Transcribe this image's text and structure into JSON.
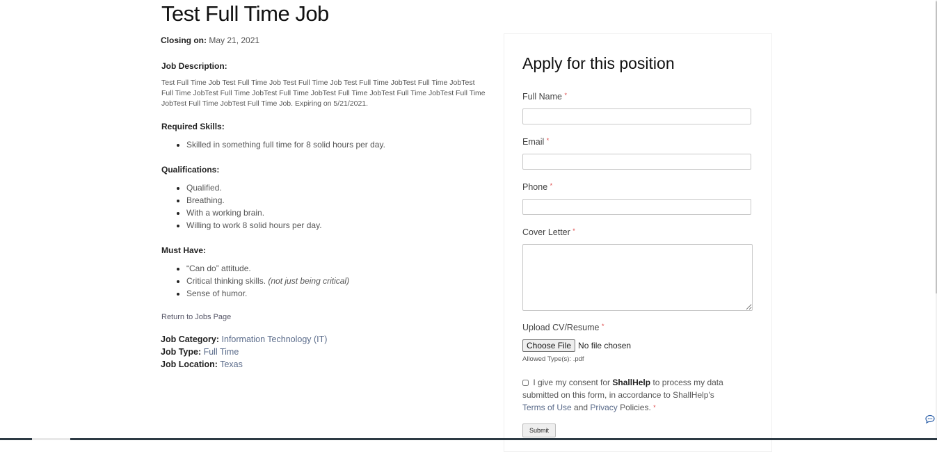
{
  "job": {
    "title": "Test Full Time Job",
    "closing_label": "Closing on:",
    "closing_date": "May 21, 2021",
    "description_heading": "Job Description:",
    "description": "Test Full Time Job Test Full Time Job Test Full Time Job Test Full Time JobTest Full Time JobTest Full Time JobTest Full Time JobTest Full Time JobTest Full Time JobTest Full Time JobTest Full Time JobTest Full Time JobTest Full Time Job. Expiring on 5/21/2021.",
    "required_skills_heading": "Required Skills:",
    "required_skills": [
      "Skilled in something full time for 8 solid hours per day."
    ],
    "qualifications_heading": "Qualifications:",
    "qualifications": [
      "Qualified.",
      "Breathing.",
      "With a working brain.",
      "Willing to work 8 solid hours per day."
    ],
    "must_have_heading": "Must Have:",
    "must_have": [
      {
        "text": "“Can do” attitude.",
        "note": ""
      },
      {
        "text": "Critical thinking skills.",
        "note": "(not just being critical)"
      },
      {
        "text": "Sense of humor.",
        "note": ""
      }
    ],
    "return_link": "Return to Jobs Page",
    "category_label": "Job Category:",
    "category": "Information Technology (IT)",
    "type_label": "Job Type:",
    "type": "Full Time",
    "location_label": "Job Location:",
    "location": "Texas"
  },
  "form": {
    "title": "Apply for this position",
    "required_mark": "*",
    "fields": {
      "full_name": {
        "label": "Full Name",
        "value": ""
      },
      "email": {
        "label": "Email",
        "value": ""
      },
      "phone": {
        "label": "Phone",
        "value": ""
      },
      "cover_letter": {
        "label": "Cover Letter",
        "value": ""
      },
      "upload": {
        "label": "Upload CV/Resume",
        "button": "Choose File",
        "status": "No file chosen",
        "allowed": "Allowed Type(s): .pdf"
      }
    },
    "consent": {
      "prefix": "I give my consent for",
      "brand": "ShallHelp",
      "middle": "to process my data submitted on this form, in accordance to ShallHelp's",
      "terms": "Terms of Use",
      "and": "and",
      "privacy": "Privacy",
      "suffix": "Policies.",
      "checked": false
    },
    "submit": "Submit"
  },
  "icons": {
    "chat": "chat-bubble-icon"
  }
}
